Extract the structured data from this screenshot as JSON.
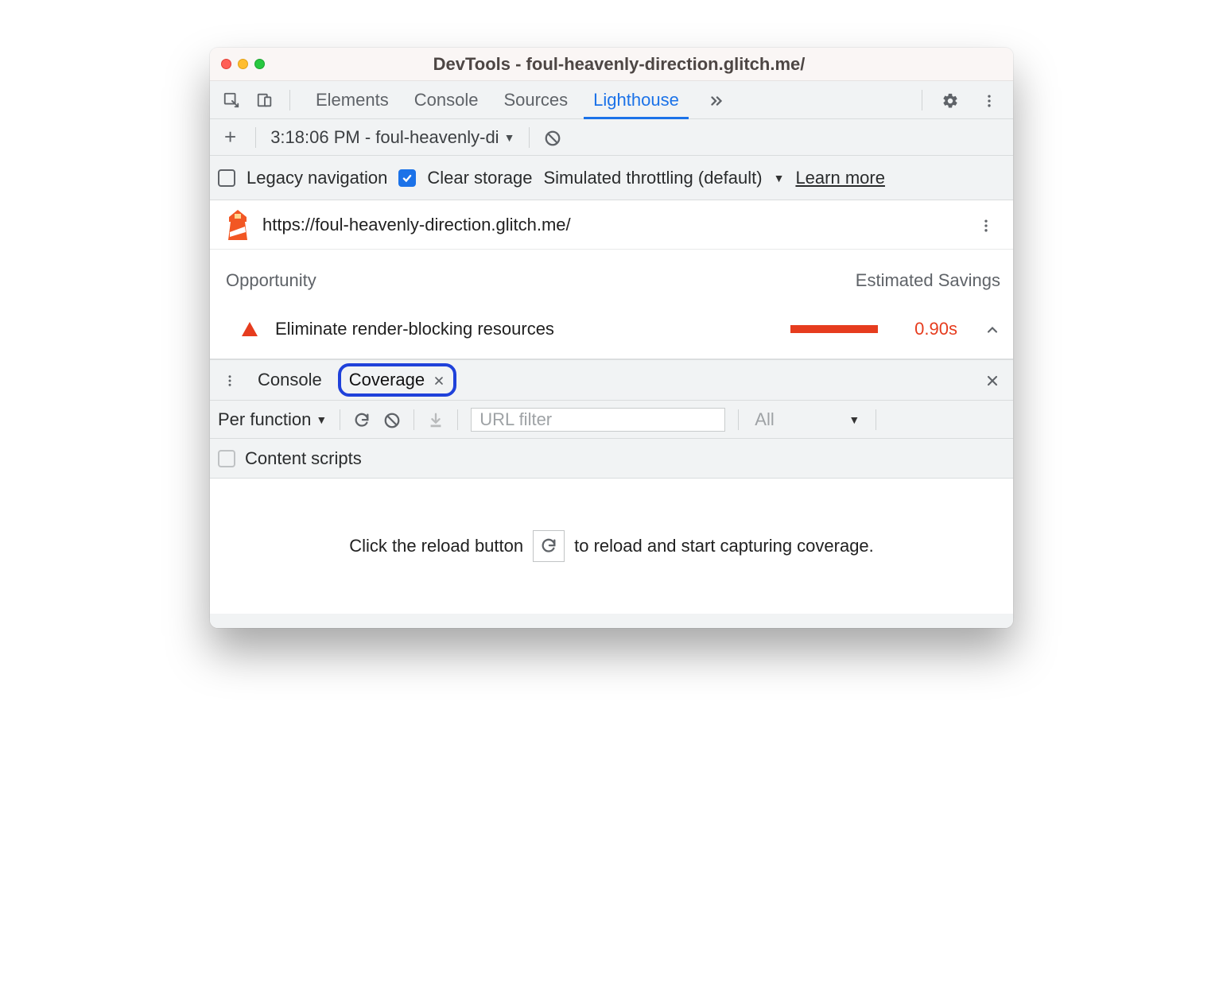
{
  "window_title": "DevTools - foul-heavenly-direction.glitch.me/",
  "tabs": [
    "Elements",
    "Console",
    "Sources",
    "Lighthouse"
  ],
  "active_tab": "Lighthouse",
  "lh": {
    "report_select": "3:18:06 PM - foul-heavenly-di",
    "legacy_label": "Legacy navigation",
    "clear_label": "Clear storage",
    "throttling_label": "Simulated throttling (default)",
    "learn_more": "Learn more",
    "url": "https://foul-heavenly-direction.glitch.me/",
    "opp_label": "Opportunity",
    "savings_label": "Estimated Savings",
    "opp_1_text": "Eliminate render-blocking resources",
    "opp_1_time": "0.90s"
  },
  "drawer": {
    "tabs": [
      "Console",
      "Coverage"
    ],
    "active": "Coverage",
    "per_function": "Per function",
    "url_filter_placeholder": "URL filter",
    "type_filter": "All",
    "content_scripts": "Content scripts",
    "msg_a": "Click the reload button",
    "msg_b": "to reload and start capturing coverage."
  }
}
